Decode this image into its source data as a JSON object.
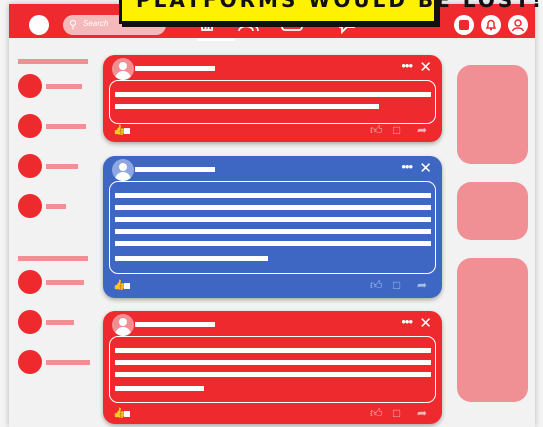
{
  "banner": {
    "text": "PLATFORMS WOULD BE LOST!"
  },
  "search": {
    "placeholder": "Search"
  },
  "icons": {
    "search": "magnifier-icon",
    "home": "home-icon",
    "friends": "people-icon",
    "video": "video-play-icon",
    "chat": "chat-bubble-icon",
    "menu": "square-menu-icon",
    "notifications": "bell-icon",
    "profile": "user-profile-icon",
    "more": "more-dots-icon",
    "close": "close-icon",
    "like": "thumbs-up-icon",
    "comment": "comment-icon",
    "share": "share-icon"
  },
  "colors": {
    "brand_red": "#ee2a2e",
    "post_blue": "#3e67c3",
    "pink_placeholder": "#f19094",
    "banner_yellow": "#fff200"
  },
  "posts": [
    {
      "name": "post-1",
      "color": "red"
    },
    {
      "name": "post-2",
      "color": "blue"
    },
    {
      "name": "post-3",
      "color": "red"
    }
  ]
}
